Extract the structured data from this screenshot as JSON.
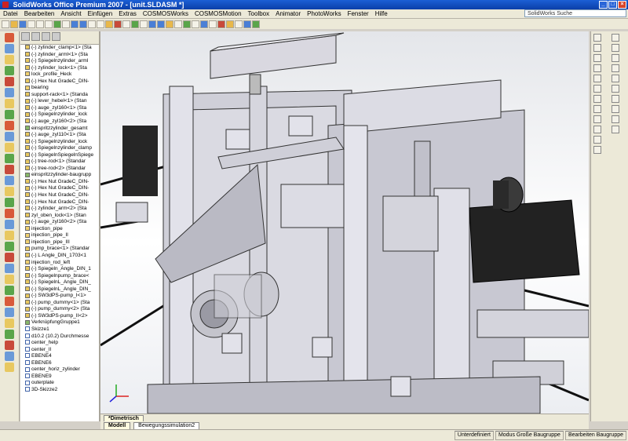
{
  "window": {
    "title": "SolidWorks Office Premium 2007 - [unit.SLDASM *]"
  },
  "menu": {
    "items": [
      "Datei",
      "Bearbeiten",
      "Ansicht",
      "Einfügen",
      "Extras",
      "COSMOSWorks",
      "COSMOSMotion",
      "Toolbox",
      "Animator",
      "PhotoWorks",
      "Fenster",
      "Hilfe"
    ]
  },
  "search": {
    "placeholder": "SolidWorks Suche"
  },
  "tree": {
    "items": [
      {
        "label": "(-) zylinder_clamp<1> (Sta",
        "kind": "part"
      },
      {
        "label": "(-) zylinder_arml<1> (Sta",
        "kind": "part"
      },
      {
        "label": "(-) Spiegelnzylinder_arml",
        "kind": "part"
      },
      {
        "label": "(-) zylinder_lock<1> (Sta",
        "kind": "part"
      },
      {
        "label": "lock_profile_Heck",
        "kind": "folder"
      },
      {
        "label": "(-) Hex Nut GradeC_DIN-",
        "kind": "part"
      },
      {
        "label": "bearing",
        "kind": "folder"
      },
      {
        "label": "support-rack<1> (Standa",
        "kind": "part"
      },
      {
        "label": "(-) lever_hebel<1> (Stan",
        "kind": "part"
      },
      {
        "label": "(-) auge_zyl160<1> (Sta",
        "kind": "part"
      },
      {
        "label": "(-) Spiegelnzylinder_lock",
        "kind": "part"
      },
      {
        "label": "(-) auge_zyl160<2> (Sta",
        "kind": "part"
      },
      {
        "label": "einspritzzylinder_gesamt",
        "kind": "asm"
      },
      {
        "label": "(-) auge_zyl110<1> (Sta",
        "kind": "part"
      },
      {
        "label": "(-) Spiegelnzylinder_lock",
        "kind": "part"
      },
      {
        "label": "(-) Spiegelnzylinder_clamp",
        "kind": "part"
      },
      {
        "label": "(-) SpiegelnSpiegelnSpiege",
        "kind": "part"
      },
      {
        "label": "(-) tree-rod<1> (Standar",
        "kind": "part"
      },
      {
        "label": "(-) tree-rod<2> (Standar",
        "kind": "part"
      },
      {
        "label": "einspritzzylinder-baugrupp",
        "kind": "asm"
      },
      {
        "label": "(-) Hex Nut GradeC_DIN-",
        "kind": "part"
      },
      {
        "label": "(-) Hex Nut GradeC_DIN-",
        "kind": "part"
      },
      {
        "label": "(-) Hex Nut GradeC_DIN-",
        "kind": "part"
      },
      {
        "label": "(-) Hex Nut GradeC_DIN-",
        "kind": "part"
      },
      {
        "label": "(-) zylinder_arm<2> (Sta",
        "kind": "part"
      },
      {
        "label": "zyl_oben_lock<1> (Stan",
        "kind": "part"
      },
      {
        "label": "(-) auge_zyl160<2> (Sta",
        "kind": "part"
      },
      {
        "label": "injection_pipe",
        "kind": "folder"
      },
      {
        "label": "injection_pipe_II",
        "kind": "folder"
      },
      {
        "label": "injection_pipe_III",
        "kind": "folder"
      },
      {
        "label": "pump_brace<1> (Standar",
        "kind": "part"
      },
      {
        "label": "(-) L Angle_DIN_1703<1",
        "kind": "part"
      },
      {
        "label": "injection_rod_left",
        "kind": "folder"
      },
      {
        "label": "(-) Spiegeln_Angle_DIN_1",
        "kind": "part"
      },
      {
        "label": "(-) Spiegelnpump_brace<",
        "kind": "part"
      },
      {
        "label": "(-) SpiegelnL_Angle_DIN_",
        "kind": "part"
      },
      {
        "label": "(-) SpiegelnL_Angle_DIN_",
        "kind": "part"
      },
      {
        "label": "(-) SW3dPS-pump_I<1>",
        "kind": "part"
      },
      {
        "label": "(-) pump_dummy<1> (Sta",
        "kind": "part"
      },
      {
        "label": "(-) pump_dummy<2> (Sta",
        "kind": "part"
      },
      {
        "label": "(-) SW3dPS-pump_II<2>",
        "kind": "part"
      },
      {
        "label": "VerknüpfungGruppe1",
        "kind": "asm"
      },
      {
        "label": "Skizze1",
        "kind": "sketch"
      },
      {
        "label": "d10.2 (10.2) Durchmesse",
        "kind": "sketch"
      },
      {
        "label": "center_help",
        "kind": "sketch"
      },
      {
        "label": "center_II",
        "kind": "sketch"
      },
      {
        "label": "EBENE4",
        "kind": "sketch"
      },
      {
        "label": "EBENE6",
        "kind": "sketch"
      },
      {
        "label": "center_horiz_zylinder",
        "kind": "sketch"
      },
      {
        "label": "EBENE9",
        "kind": "sketch"
      },
      {
        "label": "outerplate",
        "kind": "sketch"
      },
      {
        "label": "3D-Skizze2",
        "kind": "sketch"
      }
    ]
  },
  "viewport": {
    "view_label": "*Dimetrisch"
  },
  "bottom_tabs": {
    "model_label": "Modell",
    "motion_label": "Bewegungssimulation2"
  },
  "status": {
    "state": "Unterdefiniert",
    "mode": "Modus Große Baugruppe",
    "editing": "Bearbeiten Baugruppe"
  },
  "colors": {
    "title_bar": "#1c5fd6",
    "chrome": "#ece9d8",
    "machine_frame": "#d9d8e0",
    "machine_dark": "#262626"
  }
}
